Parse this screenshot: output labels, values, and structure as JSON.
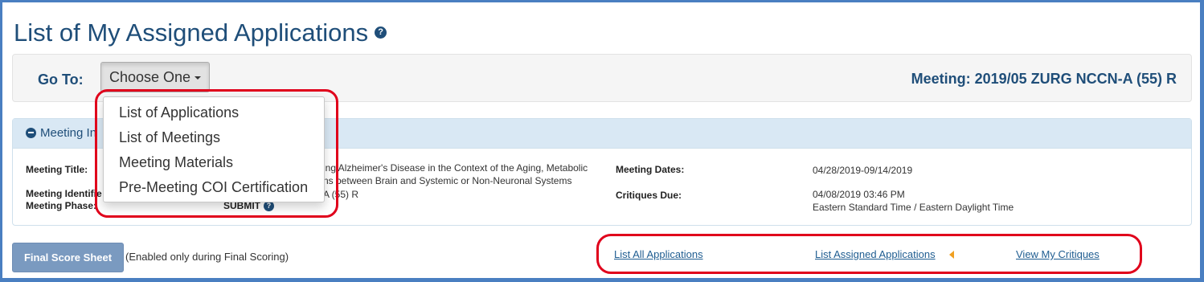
{
  "page": {
    "title": "List of My Assigned Applications",
    "help_icon": "?"
  },
  "goto": {
    "label": "Go To:",
    "button_label": "Choose One",
    "menu_items": [
      "List of Applications",
      "List of Meetings",
      "Meeting Materials",
      "Pre-Meeting COI Certification"
    ]
  },
  "meeting": {
    "label": "Meeting: 2019/05 ZURG NCCN-A (55) R"
  },
  "panel": {
    "heading": "Meeting In",
    "title_label": "Meeting Title:",
    "title_line1": "ing Alzheimer's Disease in the Context of the Aging, Metabolic",
    "title_line2": "ns between Brain and Systemic or Non-Neuronal Systems",
    "identifier_label": "Meeting Identifie",
    "identifier_value": "A (55) R",
    "phase_label": "Meeting Phase:",
    "phase_value": "SUBMIT",
    "phase_help": "?",
    "dates_label": "Meeting Dates:",
    "dates_value": "04/28/2019-09/14/2019",
    "critiques_label": "Critiques Due:",
    "critiques_value": "04/08/2019 03:46 PM",
    "critiques_tz": "Eastern Standard Time / Eastern Daylight Time"
  },
  "footer": {
    "final_button": "Final Score Sheet",
    "final_note": "(Enabled only during Final Scoring)",
    "links": [
      "List All Applications",
      "List Assigned Applications",
      "View My Critiques"
    ]
  },
  "colors": {
    "title": "#1f4e79",
    "highlight": "#e0001b",
    "frame": "#4a7fc1",
    "indicator": "#f0a020"
  }
}
